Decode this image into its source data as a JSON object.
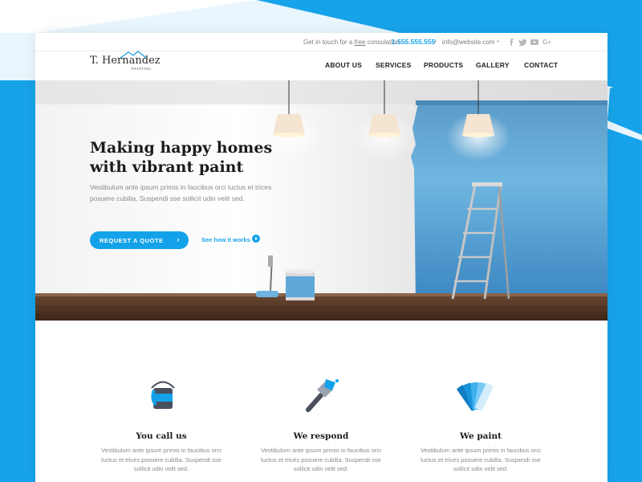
{
  "colors": {
    "accent": "#13a2e9",
    "backdrop": "#17a3ea",
    "text_dark": "#1b1b1b",
    "text_muted": "#8a8a8a"
  },
  "topbar": {
    "contact_prefix": "Get in touch for a",
    "contact_free": "free",
    "contact_suffix": "consulation",
    "phone": "1.555.555.555",
    "email": "info@website.com",
    "social": [
      "facebook-icon",
      "twitter-icon",
      "youtube-icon",
      "google-plus-icon"
    ]
  },
  "logo": {
    "brand": "T. Hernandez",
    "sub": "PAINTING"
  },
  "nav": {
    "about": "ABOUT US",
    "services": "SERVICES",
    "products": "PRODUCTS",
    "gallery": "GALLERY",
    "contact": "CONTACT"
  },
  "hero": {
    "title": "Making happy homes with vibrant paint",
    "subtitle": "Vestibulum ante ipsum primis in faucibus orci luctus et trices posuere cubilia. Suspendi sse sollicit udin velit sed.",
    "cta": "REQUEST A QUOTE",
    "cta_icon": "chevron-right-icon",
    "secondary": "See how it works",
    "secondary_icon": "play-icon"
  },
  "features": [
    {
      "title": "You call us",
      "icon": "paint-can-icon",
      "text": "Vestibulum ante ipsum primis in faucibus orci luctus et trices posuere cubilia. Suspendi sse sollicit udin velit sed."
    },
    {
      "title": "We respond",
      "icon": "paint-brush-icon",
      "text": "Vestibulum ante ipsum primis in faucibus orci luctus et trices posuere cubilia. Suspendi sse sollicit udin velit sed."
    },
    {
      "title": "We paint",
      "icon": "color-swatch-icon",
      "text": "Vestibulum ante ipsum primis in faucibus orci luctus et trices posuere cubilia. Suspendi sse sollicit udin velit sed."
    }
  ]
}
